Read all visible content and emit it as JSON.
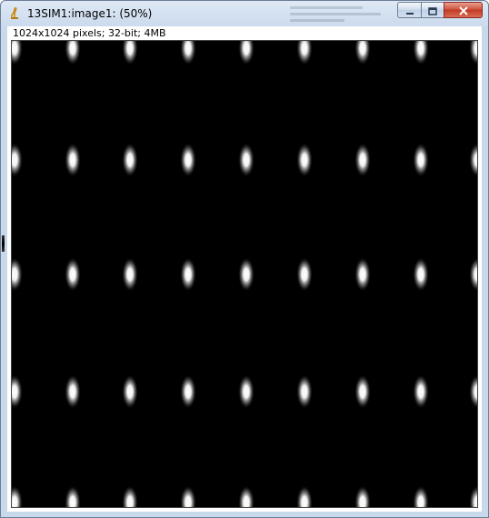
{
  "window": {
    "title": "13SIM1:image1: (50%)",
    "icon": "imagej-microscope-icon",
    "buttons": {
      "minimize_icon": "minimize-icon",
      "maximize_icon": "maximize-icon",
      "close_icon": "close-icon"
    }
  },
  "image": {
    "info": "1024x1024 pixels; 32-bit; 4MB",
    "zoom": "50%",
    "background_color": "#000000",
    "spot_color": "#ffffff",
    "pattern": {
      "columns": 9,
      "rows": 5
    }
  }
}
